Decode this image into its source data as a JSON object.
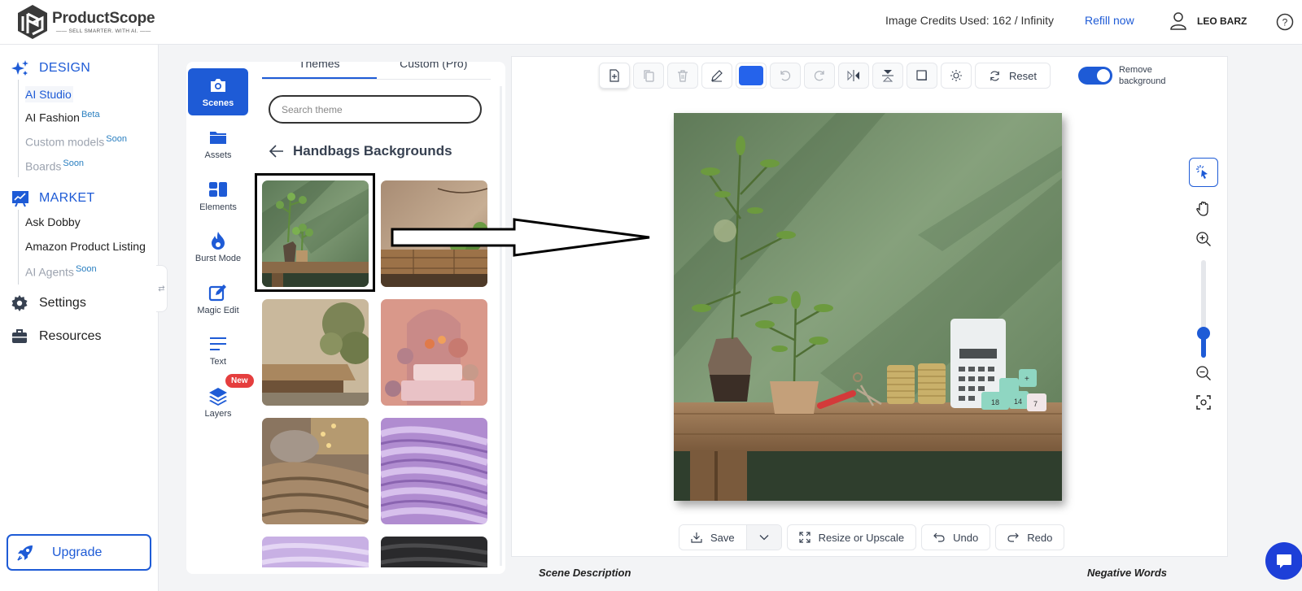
{
  "brand": {
    "name": "ProductScope",
    "tagline": "SELL SMARTER. WITH AI."
  },
  "header": {
    "credits": "Image Credits Used: 162 / Infinity",
    "refill_label": "Refill now",
    "user_name": "LEO BARZ",
    "user_icon": "user-icon",
    "help_icon": "help-icon"
  },
  "colors": {
    "accent": "#1e5bd6",
    "selected_color": "#2563eb",
    "badge_new": "#e53e3e",
    "chat_fab": "#1d3fd8"
  },
  "sidebar": {
    "design": {
      "label": "DESIGN",
      "icon": "sparkles-icon",
      "items": [
        {
          "label": "AI Studio",
          "badge": "",
          "state": "active"
        },
        {
          "label": "AI Fashion",
          "badge": "Beta",
          "state": "normal"
        },
        {
          "label": "Custom models",
          "badge": "Soon",
          "state": "disabled"
        },
        {
          "label": "Boards",
          "badge": "Soon",
          "state": "disabled"
        }
      ]
    },
    "market": {
      "label": "MARKET",
      "icon": "chart-board-icon",
      "items": [
        {
          "label": "Ask Dobby",
          "badge": "",
          "state": "normal"
        },
        {
          "label": "Amazon Product Listing",
          "badge": "",
          "state": "normal"
        },
        {
          "label": "AI Agents",
          "badge": "Soon",
          "state": "disabled"
        }
      ]
    },
    "settings_label": "Settings",
    "resources_label": "Resources",
    "upgrade_label": "Upgrade",
    "collapse_glyph": "⇄"
  },
  "tools": [
    {
      "label": "Scenes",
      "icon": "camera-icon",
      "active": true
    },
    {
      "label": "Assets",
      "icon": "folder-icon",
      "active": false
    },
    {
      "label": "Elements",
      "icon": "elements-icon",
      "active": false
    },
    {
      "label": "Burst Mode",
      "icon": "flame-icon",
      "active": false
    },
    {
      "label": "Magic Edit",
      "icon": "edit-icon",
      "active": false
    },
    {
      "label": "Text",
      "icon": "text-lines-icon",
      "active": false
    },
    {
      "label": "Layers",
      "icon": "layers-icon",
      "active": false,
      "badge": "New"
    }
  ],
  "scenes": {
    "tabs": [
      {
        "label": "Themes",
        "active": true
      },
      {
        "label": "Custom (Pro)",
        "active": false
      }
    ],
    "search_placeholder": "Search theme",
    "search_value": "",
    "category_title": "Handbags Backgrounds",
    "thumbnails": [
      {
        "name": "green-wall-wooden-bench",
        "selected": true
      },
      {
        "name": "beige-wall-wood-table-plant",
        "selected": false
      },
      {
        "name": "beige-wall-table-olive-tree",
        "selected": false
      },
      {
        "name": "pink-arch-flowers-podium",
        "selected": false
      },
      {
        "name": "brown-fur-blanket",
        "selected": false
      },
      {
        "name": "purple-fur",
        "selected": false
      },
      {
        "name": "lavender-fur",
        "selected": false
      },
      {
        "name": "dark-fur",
        "selected": false
      }
    ]
  },
  "toolbar": {
    "buttons": [
      {
        "name": "add-page",
        "icon": "file-plus-icon",
        "disabled": false
      },
      {
        "name": "duplicate",
        "icon": "copy-icon",
        "disabled": true
      },
      {
        "name": "delete",
        "icon": "trash-icon",
        "disabled": true
      },
      {
        "name": "edit",
        "icon": "pencil-icon",
        "disabled": false
      }
    ],
    "color_value": "#2563eb",
    "buttons2": [
      {
        "name": "rotate-left",
        "icon": "rotate-ccw-icon",
        "disabled": true
      },
      {
        "name": "rotate-right",
        "icon": "rotate-cw-icon",
        "disabled": true
      },
      {
        "name": "flip-horizontal",
        "icon": "flip-h-icon",
        "disabled": true
      },
      {
        "name": "flip-vertical",
        "icon": "flip-v-icon",
        "disabled": true
      },
      {
        "name": "shadow",
        "icon": "shadow-square-icon",
        "disabled": true
      },
      {
        "name": "brightness",
        "icon": "sun-icon",
        "disabled": false
      }
    ],
    "reset_label": "Reset",
    "remove_bg_label_1": "Remove",
    "remove_bg_label_2": "background",
    "remove_bg_on": true
  },
  "canvas": {
    "image_description": "Green textured wall with wooden bench, potted plants, coins, keys, calculator and number dice",
    "zoom_level": 0.25
  },
  "right_tools": [
    {
      "name": "select",
      "icon": "select-pointer-icon",
      "active": true
    },
    {
      "name": "pan",
      "icon": "hand-icon",
      "active": false
    },
    {
      "name": "zoom-in",
      "icon": "zoom-in-icon",
      "active": false
    },
    {
      "name": "zoom-out",
      "icon": "zoom-out-icon",
      "active": false
    },
    {
      "name": "fit",
      "icon": "focus-frame-icon",
      "active": false
    }
  ],
  "bottom": {
    "save_label": "Save",
    "resize_label": "Resize or Upscale",
    "undo_label": "Undo",
    "redo_label": "Redo"
  },
  "fields": {
    "scene_description_label": "Scene Description",
    "negative_words_label": "Negative Words"
  },
  "chat_icon": "chat-bubble-icon"
}
